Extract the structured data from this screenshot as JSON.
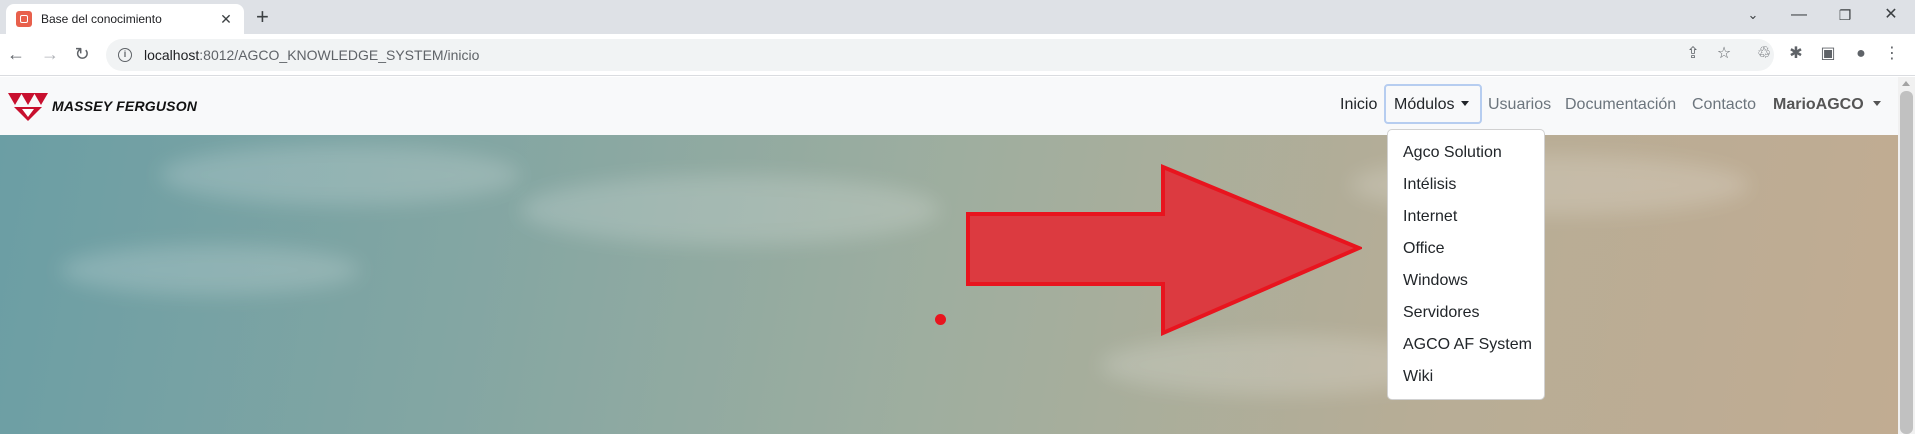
{
  "browser": {
    "tab_title": "Base del conocimiento",
    "url_host": "localhost",
    "url_path": ":8012/AGCO_KNOWLEDGE_SYSTEM/inicio"
  },
  "site": {
    "brand": "MASSEY FERGUSON",
    "nav": {
      "inicio": "Inicio",
      "modulos": "Módulos",
      "usuarios": "Usuarios",
      "documentacion": "Documentación",
      "contacto": "Contacto",
      "user": "MarioAGCO"
    },
    "modulos_menu": [
      "Agco Solution",
      "Intélisis",
      "Internet",
      "Office",
      "Windows",
      "Servidores",
      "AGCO AF System",
      "Wiki"
    ]
  },
  "colors": {
    "annotation_red": "#e8141e",
    "brand_red": "#c8102e"
  }
}
